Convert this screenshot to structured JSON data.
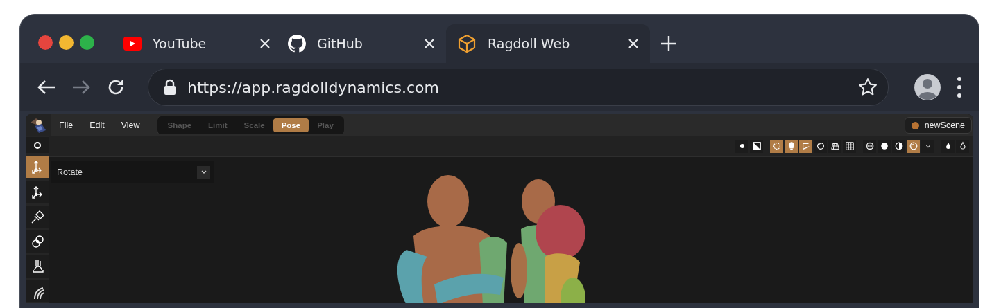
{
  "browser": {
    "tabs": [
      {
        "title": "YouTube",
        "kind": "youtube",
        "selected": false
      },
      {
        "title": "GitHub",
        "kind": "github",
        "selected": false
      },
      {
        "title": "Ragdoll Web",
        "kind": "cube",
        "selected": true
      }
    ],
    "url": "https://app.ragdolldynamics.com"
  },
  "app": {
    "menu": [
      "File",
      "Edit",
      "View"
    ],
    "modes": [
      {
        "label": "Shape",
        "selected": false
      },
      {
        "label": "Limit",
        "selected": false
      },
      {
        "label": "Scale",
        "selected": false
      },
      {
        "label": "Pose",
        "selected": true
      },
      {
        "label": "Play",
        "selected": false
      }
    ],
    "scene": {
      "name": "newScene",
      "color": "#b87333"
    },
    "tools": [
      {
        "kind": "rotate",
        "selected": true
      },
      {
        "kind": "move",
        "selected": false
      },
      {
        "kind": "pin",
        "selected": false
      },
      {
        "kind": "link",
        "selected": false
      },
      {
        "kind": "ground",
        "selected": false
      },
      {
        "kind": "wind",
        "selected": false
      }
    ],
    "viewport_toggles": [
      [
        {
          "kind": "dot",
          "on": false
        },
        {
          "kind": "exposure",
          "on": false
        }
      ],
      [
        {
          "kind": "ring",
          "on": true
        },
        {
          "kind": "bulb",
          "on": true
        },
        {
          "kind": "ruler",
          "on": true
        },
        {
          "kind": "circle",
          "on": false
        },
        {
          "kind": "floor",
          "on": false
        },
        {
          "kind": "grid",
          "on": false
        }
      ],
      [
        {
          "kind": "globe",
          "on": false
        },
        {
          "kind": "sphere",
          "on": false
        },
        {
          "kind": "half",
          "on": false
        },
        {
          "kind": "shaded",
          "on": true
        },
        {
          "kind": "chevron",
          "on": false
        }
      ],
      [
        {
          "kind": "drop",
          "on": false
        },
        {
          "kind": "drop-outline",
          "on": false
        }
      ]
    ],
    "manipulator": {
      "value": "Rotate"
    }
  }
}
